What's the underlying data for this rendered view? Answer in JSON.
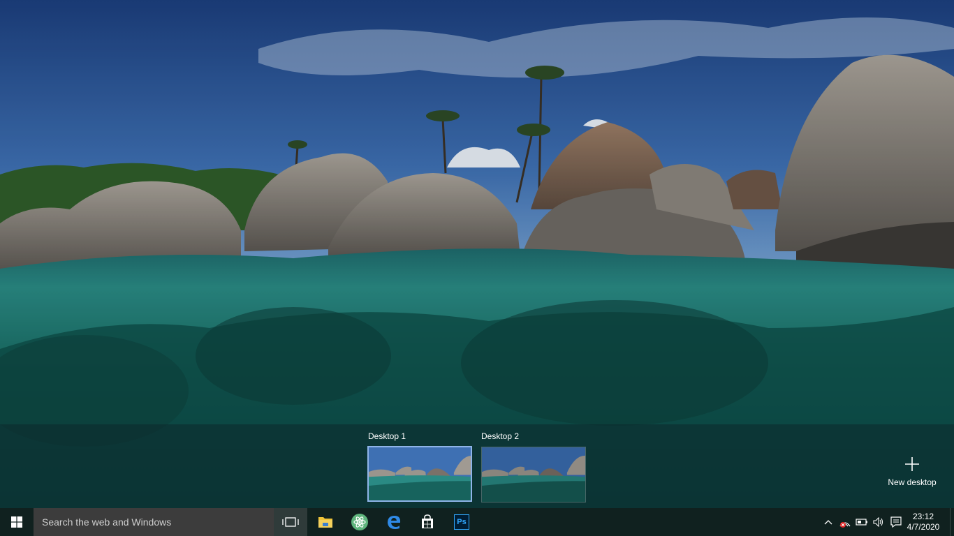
{
  "task_view": {
    "desktops": [
      {
        "label": "Desktop 1",
        "active": true
      },
      {
        "label": "Desktop 2",
        "active": false
      }
    ],
    "new_desktop_label": "New desktop"
  },
  "taskbar": {
    "search_placeholder": "Search the web and Windows",
    "pinned_apps": [
      "file-explorer-icon",
      "atom-editor-icon",
      "edge-browser-icon",
      "store-icon",
      "photoshop-icon"
    ],
    "photoshop_glyph": "Ps",
    "tray_icons": [
      "chevron-up-icon",
      "network-icon",
      "battery-icon",
      "volume-icon",
      "action-center-icon"
    ],
    "clock_time": "23:12",
    "clock_date": "4/7/2020"
  },
  "colors": {
    "accent": "#8fb4e8",
    "taskbar": "#10211f",
    "search": "#3c3c3c"
  }
}
